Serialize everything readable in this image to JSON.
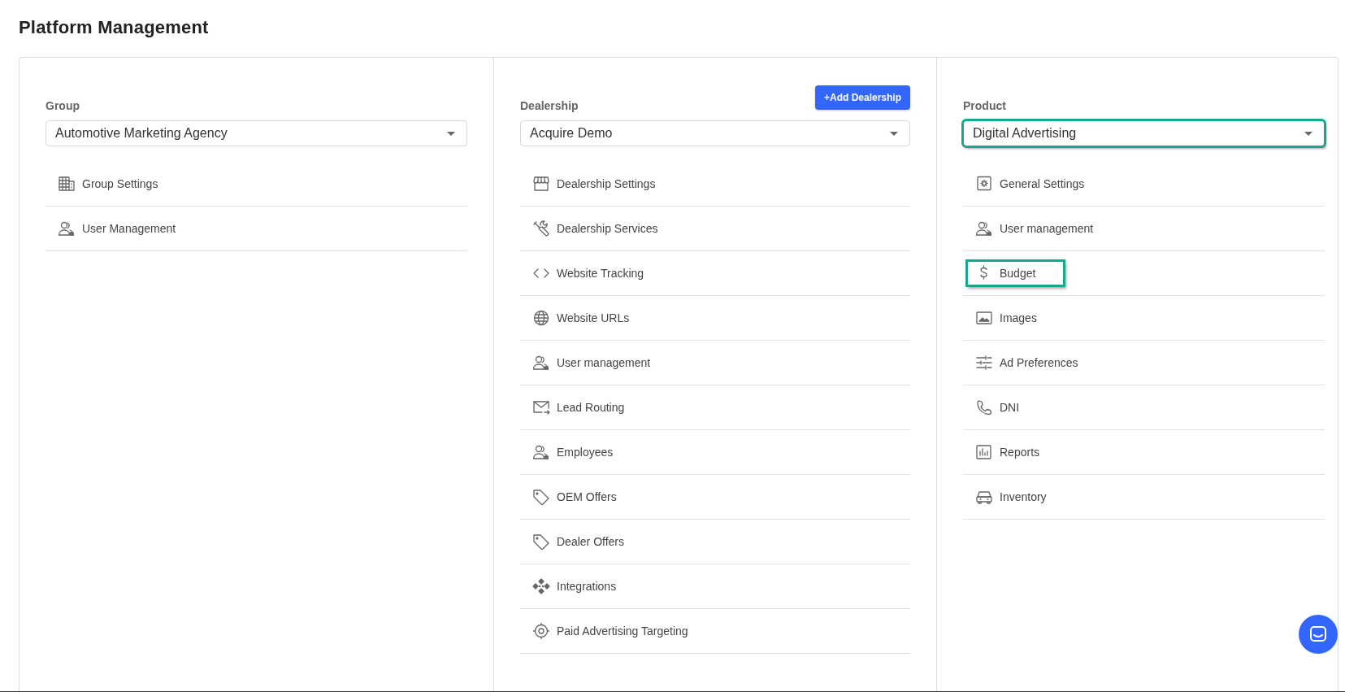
{
  "page": {
    "title": "Platform Management"
  },
  "columns": [
    {
      "label": "Group",
      "select": {
        "value": "Automotive Marketing Agency",
        "highlighted": false
      },
      "items": [
        {
          "label": "Group Settings",
          "highlighted": false
        },
        {
          "label": "User Management",
          "highlighted": false
        }
      ]
    },
    {
      "label": "Dealership",
      "button": "+Add Dealership",
      "select": {
        "value": "Acquire Demo",
        "highlighted": false
      },
      "items": [
        {
          "label": "Dealership Settings",
          "highlighted": false
        },
        {
          "label": "Dealership Services",
          "highlighted": false
        },
        {
          "label": "Website Tracking",
          "highlighted": false
        },
        {
          "label": "Website URLs",
          "highlighted": false
        },
        {
          "label": "User management",
          "highlighted": false
        },
        {
          "label": "Lead Routing",
          "highlighted": false
        },
        {
          "label": "Employees",
          "highlighted": false
        },
        {
          "label": "OEM Offers",
          "highlighted": false
        },
        {
          "label": "Dealer Offers",
          "highlighted": false
        },
        {
          "label": "Integrations",
          "highlighted": false
        },
        {
          "label": "Paid Advertising Targeting",
          "highlighted": false
        }
      ]
    },
    {
      "label": "Product",
      "select": {
        "value": "Digital Advertising",
        "highlighted": true
      },
      "items": [
        {
          "label": "General Settings",
          "highlighted": false
        },
        {
          "label": "User management",
          "highlighted": false
        },
        {
          "label": "Budget",
          "highlighted": true
        },
        {
          "label": "Images",
          "highlighted": false
        },
        {
          "label": "Ad Preferences",
          "highlighted": false
        },
        {
          "label": "DNI",
          "highlighted": false
        },
        {
          "label": "Reports",
          "highlighted": false
        },
        {
          "label": "Inventory",
          "highlighted": false
        }
      ]
    }
  ]
}
